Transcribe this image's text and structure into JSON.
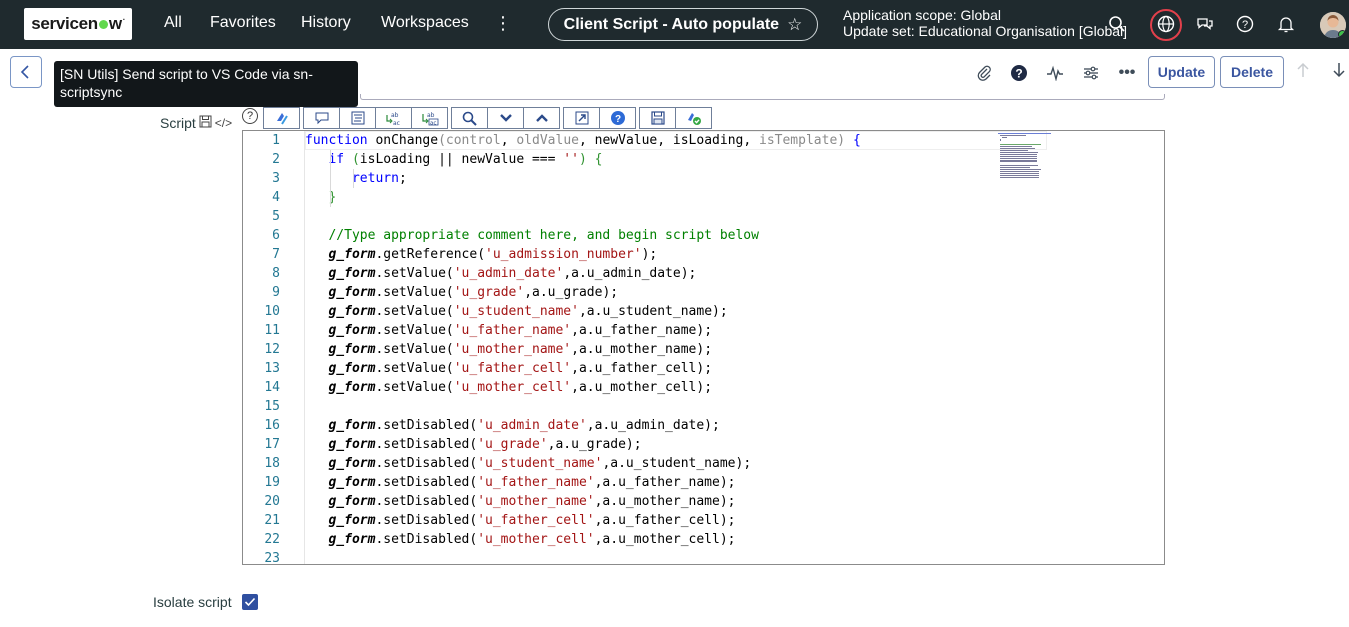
{
  "nav": {
    "logo_text": "servicenow",
    "items": [
      "All",
      "Favorites",
      "History",
      "Workspaces"
    ],
    "more_icon": "kebab-vertical-icon",
    "record_title": "Client Script - Auto populate",
    "scope_line1": "Application scope: Global",
    "scope_line2": "Update set: Educational Organisation [Global]",
    "icons": [
      "search-icon",
      "globe-icon",
      "chat-icon",
      "help-icon",
      "bell-icon",
      "avatar"
    ]
  },
  "header": {
    "tooltip": "[SN Utils] Send script to VS Code via sn-scriptsync",
    "update_label": "Update",
    "delete_label": "Delete",
    "icons": [
      "attachment-icon",
      "help-filled-icon",
      "activity-icon",
      "settings-sliders-icon",
      "more-icon"
    ]
  },
  "script_field": {
    "label": "Script",
    "toolbar_icons": [
      "sn-scriptsync-icon",
      "comment-icon",
      "format-icon",
      "replace-icon",
      "replace-all-icon",
      "search-icon",
      "find-next-icon",
      "find-prev-icon",
      "fullscreen-icon",
      "help-icon",
      "save-icon",
      "script-check-icon"
    ],
    "lines": [
      "function onChange(control, oldValue, newValue, isLoading, isTemplate) {",
      "   if (isLoading || newValue === '') {",
      "      return;",
      "   }",
      "",
      "   //Type appropriate comment here, and begin script below",
      "   g_form.getReference('u_admission_number');",
      "   g_form.setValue('u_admin_date',a.u_admin_date);",
      "   g_form.setValue('u_grade',a.u_grade);",
      "   g_form.setValue('u_student_name',a.u_student_name);",
      "   g_form.setValue('u_father_name',a.u_father_name);",
      "   g_form.setValue('u_mother_name',a.u_mother_name);",
      "   g_form.setValue('u_father_cell',a.u_father_cell);",
      "   g_form.setValue('u_mother_cell',a.u_mother_cell);",
      "",
      "   g_form.setDisabled('u_admin_date',a.u_admin_date);",
      "   g_form.setDisabled('u_grade',a.u_grade);",
      "   g_form.setDisabled('u_student_name',a.u_student_name);",
      "   g_form.setDisabled('u_father_name',a.u_father_name);",
      "   g_form.setDisabled('u_mother_name',a.u_mother_name);",
      "   g_form.setDisabled('u_father_cell',a.u_father_cell);",
      "   g_form.setDisabled('u_mother_cell',a.u_mother_cell);",
      ""
    ]
  },
  "isolate": {
    "label": "Isolate script",
    "checked": true
  },
  "colors": {
    "nav_bg": "#1f2a2e",
    "accent": "#3b56a0",
    "alert_ring": "#e2404b"
  }
}
